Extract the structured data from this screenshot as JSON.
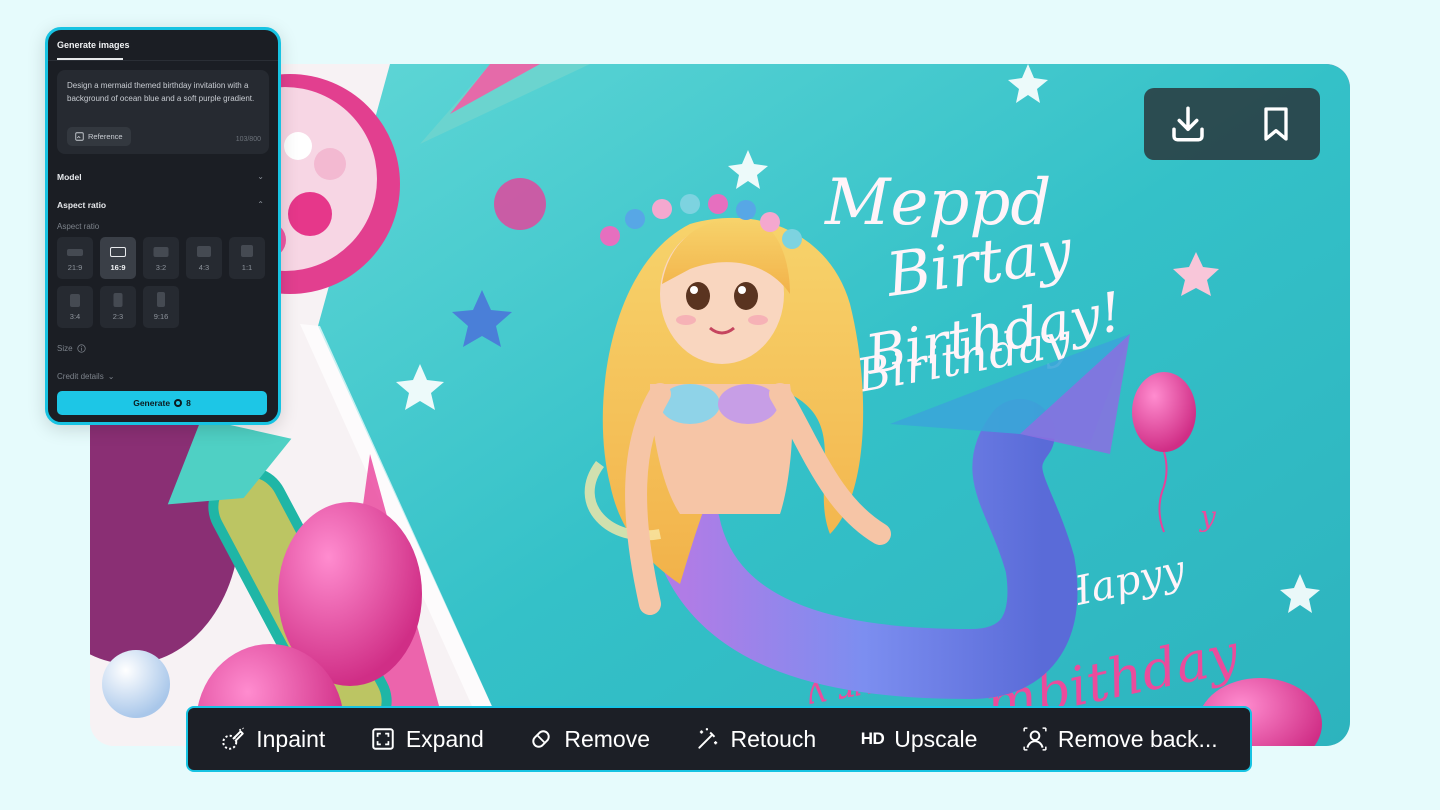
{
  "panel": {
    "tab_label": "Generate images",
    "prompt": "Design a mermaid themed birthday invitation with a background of ocean blue and a soft purple gradient.",
    "reference_label": "Reference",
    "char_count": "103/800",
    "model_label": "Model",
    "aspect_section_label": "Aspect ratio",
    "aspect_sub_label": "Aspect ratio",
    "ratios": [
      "21:9",
      "16:9",
      "3:2",
      "4:3",
      "1:1",
      "3:4",
      "2:3",
      "9:16"
    ],
    "selected_ratio": "16:9",
    "size_label": "Size",
    "credit_label": "Credit details",
    "generate_label": "Generate",
    "generate_cost": "8"
  },
  "image": {
    "card_text": [
      "Meppd",
      "Birtay",
      "Birthday!",
      "Birithday",
      "Hapyy",
      "y",
      "ʎ ɹʎd",
      "mbithday"
    ],
    "icons": [
      "download-icon",
      "bookmark-icon"
    ]
  },
  "toolbar": {
    "inpaint": "Inpaint",
    "expand": "Expand",
    "remove": "Remove",
    "retouch": "Retouch",
    "hd_badge": "HD",
    "upscale": "Upscale",
    "remove_background": "Remove back..."
  },
  "colors": {
    "accent": "#17c3e2",
    "page_bg": "#e6fbfc",
    "panel_bg": "#1b1e24",
    "card_teal": "#35c3c9",
    "pink": "#e8409a"
  }
}
